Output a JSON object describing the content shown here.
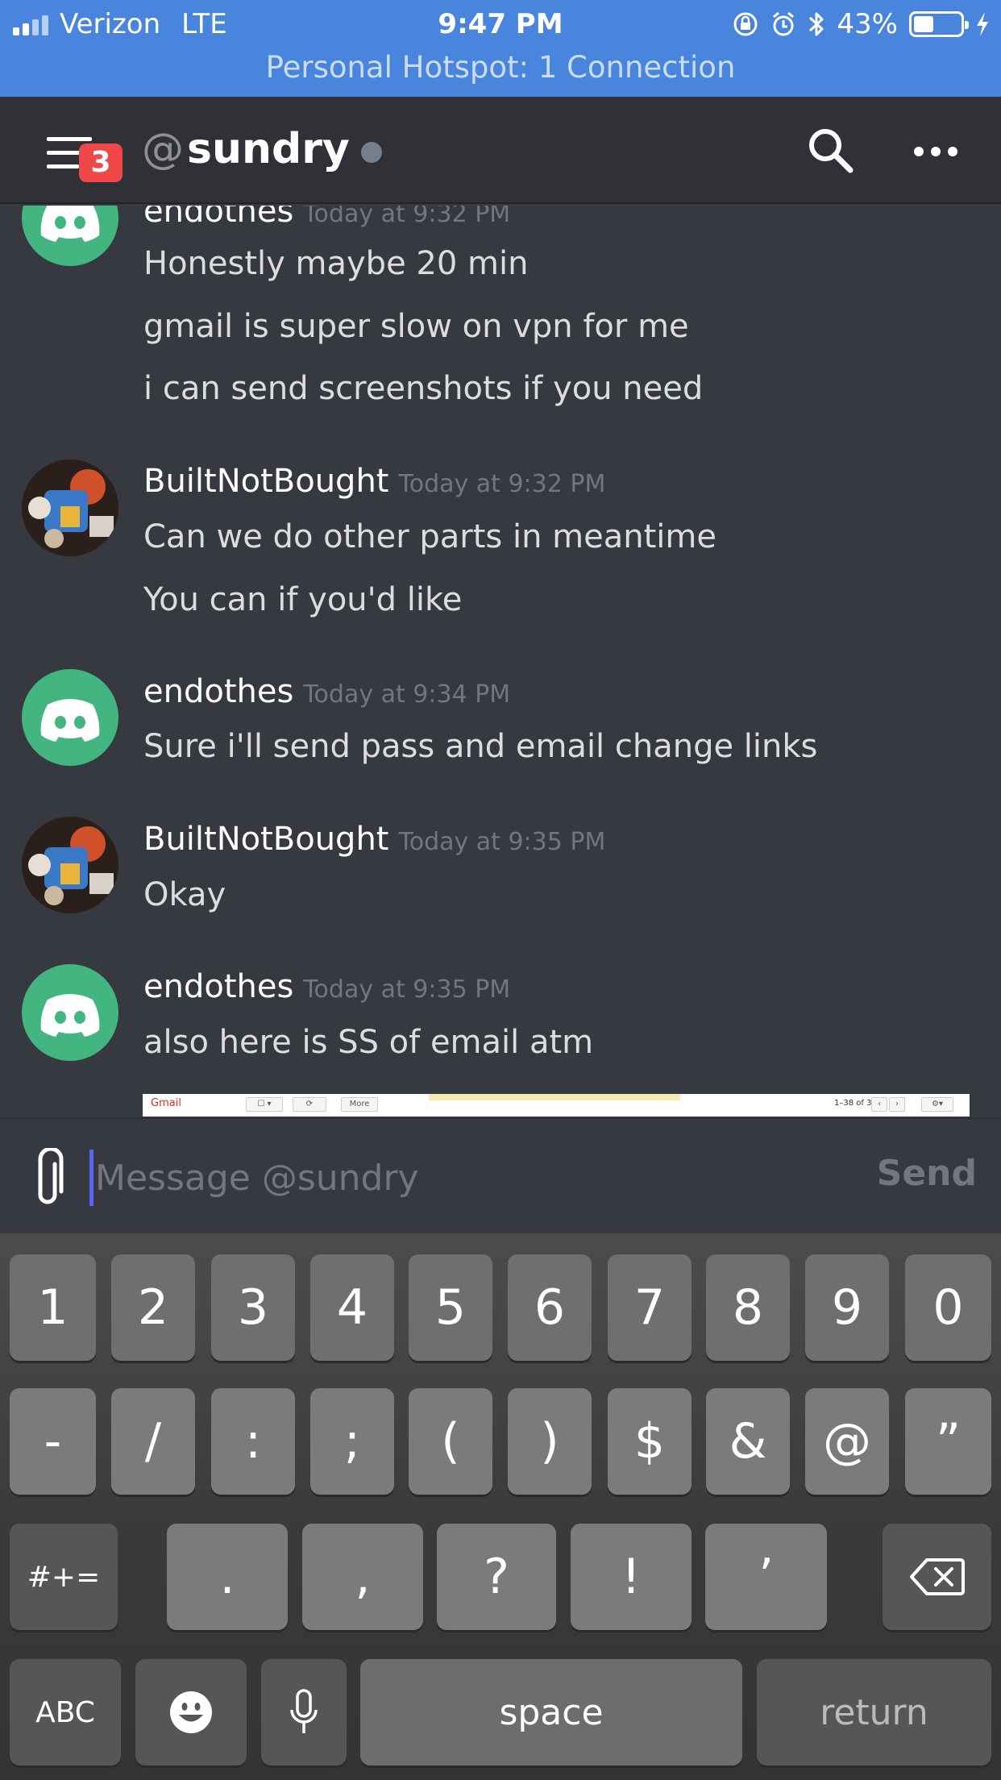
{
  "status_bar": {
    "carrier": "Verizon",
    "network": "LTE",
    "time": "9:47 PM",
    "battery": "43%",
    "battery_level": 0.43,
    "hotspot": "Personal Hotspot: 1 Connection",
    "icons": [
      "signal-icon",
      "orientation-lock-icon",
      "alarm-icon",
      "bluetooth-icon",
      "battery-icon",
      "charging-icon"
    ]
  },
  "header": {
    "badge": "3",
    "at": "@",
    "channel": "sundry",
    "icons": [
      "hamburger-icon",
      "search-icon",
      "more-icon"
    ]
  },
  "messages": [
    {
      "author": "endothes",
      "time": "Today at 9:32 PM",
      "avatar": "discord-avatar",
      "lines": [
        "Honestly maybe 20 min",
        "gmail is super slow on vpn for me",
        "i can send screenshots if you need"
      ]
    },
    {
      "author": "BuiltNotBought",
      "time": "Today at 9:32 PM",
      "avatar": "user-avatar",
      "lines": [
        "Can we do other parts in meantime",
        "You can if you'd like"
      ]
    },
    {
      "author": "endothes",
      "time": "Today at 9:34 PM",
      "avatar": "discord-avatar",
      "lines": [
        "Sure i'll send pass and email change links"
      ]
    },
    {
      "author": "BuiltNotBought",
      "time": "Today at 9:35 PM",
      "avatar": "user-avatar",
      "lines": [
        "Okay"
      ]
    },
    {
      "author": "endothes",
      "time": "Today at 9:35 PM",
      "avatar": "discord-avatar",
      "lines": [
        "also here is SS of email atm"
      ]
    }
  ],
  "attachment": {
    "gmail_label": "Gmail",
    "more_label": "More",
    "range": "1–38 of 38"
  },
  "input": {
    "placeholder": "Message @sundry",
    "value": "",
    "send_label": "Send"
  },
  "keyboard": {
    "row1": [
      "1",
      "2",
      "3",
      "4",
      "5",
      "6",
      "7",
      "8",
      "9",
      "0"
    ],
    "row2": [
      "-",
      "/",
      ":",
      ";",
      "(",
      ")",
      "$",
      "&",
      "@",
      "”"
    ],
    "row3_left": "#+=",
    "row3": [
      ".",
      ",",
      "?",
      "!",
      "’"
    ],
    "abc": "ABC",
    "space": "space",
    "return": "return"
  }
}
